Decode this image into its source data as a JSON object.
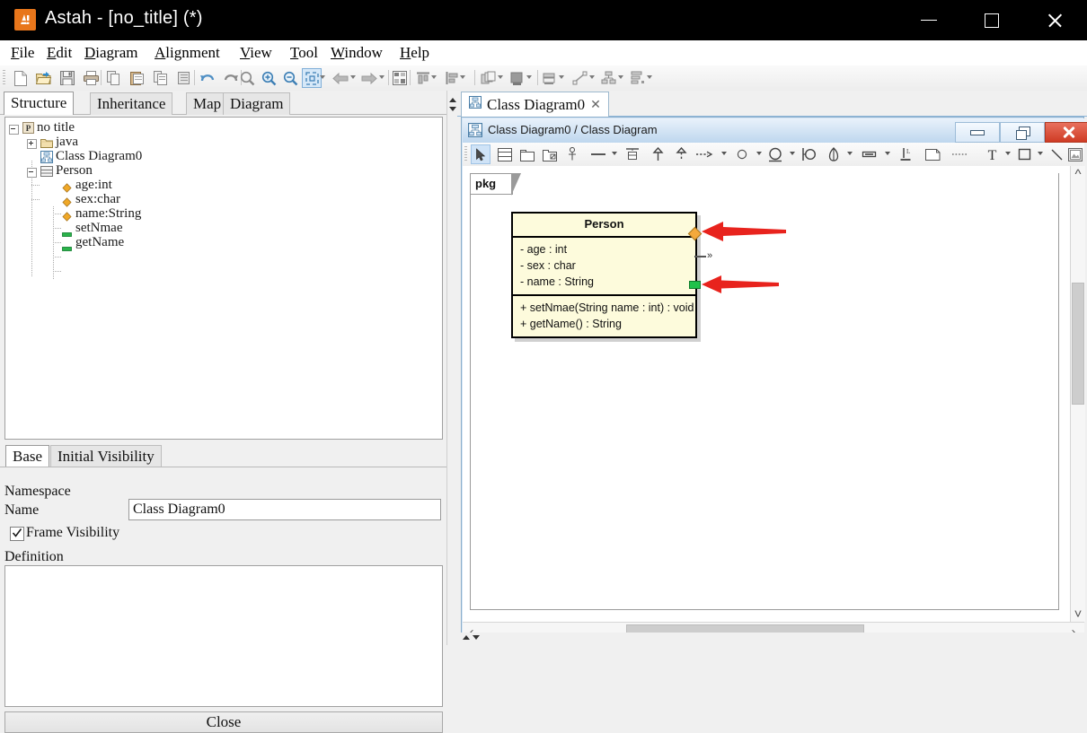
{
  "window": {
    "app_icon": "astah-logo-icon",
    "title": "Astah - [no_title] (*)",
    "minimize": "minimize-icon",
    "maximize": "maximize-icon",
    "close": "close-icon"
  },
  "menubar": {
    "items": [
      {
        "label": "File",
        "mnemonic": "F"
      },
      {
        "label": "Edit",
        "mnemonic": "E"
      },
      {
        "label": "Diagram",
        "mnemonic": "D"
      },
      {
        "label": "Alignment",
        "mnemonic": "A"
      },
      {
        "label": "View",
        "mnemonic": "V"
      },
      {
        "label": "Tool",
        "mnemonic": "T"
      },
      {
        "label": "Window",
        "mnemonic": "W"
      },
      {
        "label": "Help",
        "mnemonic": "H"
      }
    ]
  },
  "toolbar": {
    "buttons": [
      {
        "name": "new-project-icon"
      },
      {
        "name": "open-project-icon"
      },
      {
        "name": "save-icon"
      },
      {
        "name": "print-icon"
      },
      {
        "name": "copy-icon"
      },
      {
        "name": "paste-icon"
      },
      {
        "name": "copy-as-image-icon"
      },
      {
        "name": "paste-special-icon"
      },
      {
        "name": "undo-icon"
      },
      {
        "name": "redo-icon"
      },
      {
        "name": "zoom-reset-icon"
      },
      {
        "name": "zoom-in-icon"
      },
      {
        "name": "zoom-out-icon"
      },
      {
        "name": "fit-to-window-icon"
      },
      {
        "name": "back-icon"
      },
      {
        "name": "forward-icon"
      },
      {
        "name": "layout-icon"
      },
      {
        "name": "align-top-icon"
      },
      {
        "name": "align-left-icon"
      },
      {
        "name": "stack-icon"
      },
      {
        "name": "bring-front-icon"
      },
      {
        "name": "send-back-icon"
      },
      {
        "name": "line-style-icon"
      },
      {
        "name": "tree-layout-icon"
      },
      {
        "name": "list-layout-icon"
      }
    ]
  },
  "left_panel": {
    "tabs": [
      {
        "label": "Structure",
        "active": true
      },
      {
        "label": "Inheritance",
        "active": false
      },
      {
        "label": "Map",
        "active": false
      },
      {
        "label": "Diagram",
        "active": false
      }
    ],
    "tree": [
      {
        "label": "no title",
        "depth": 0,
        "icon": "project-icon",
        "expander": "minus"
      },
      {
        "label": "java",
        "depth": 1,
        "icon": "package-icon",
        "expander": "plus"
      },
      {
        "label": "Class Diagram0",
        "depth": 1,
        "icon": "class-diagram-icon",
        "expander": "none"
      },
      {
        "label": "Person",
        "depth": 1,
        "icon": "class-icon",
        "expander": "minus"
      },
      {
        "label": "age:int",
        "depth": 2,
        "icon": "attribute-icon",
        "expander": "none"
      },
      {
        "label": "sex:char",
        "depth": 2,
        "icon": "attribute-icon",
        "expander": "none"
      },
      {
        "label": "name:String",
        "depth": 2,
        "icon": "attribute-icon",
        "expander": "none"
      },
      {
        "label": "setNmae",
        "depth": 2,
        "icon": "operation-icon",
        "expander": "none"
      },
      {
        "label": "getName",
        "depth": 2,
        "icon": "operation-icon",
        "expander": "none"
      }
    ]
  },
  "property_panel": {
    "tabs": [
      {
        "label": "Base",
        "active": true
      },
      {
        "label": "Initial Visibility",
        "active": false
      }
    ],
    "namespace_label": "Namespace",
    "namespace_value": "",
    "name_label": "Name",
    "name_value": "Class Diagram0",
    "frame_visibility_label": "Frame Visibility",
    "frame_visibility_checked": true,
    "definition_label": "Definition",
    "definition_value": "",
    "close_label": "Close"
  },
  "diagram_tabs": [
    {
      "label": "Class Diagram0",
      "icon": "class-diagram-icon",
      "close": "close-tab-icon",
      "active": true
    }
  ],
  "mdi_window": {
    "icon": "class-diagram-icon",
    "title": "Class Diagram0 / Class Diagram",
    "minimize": "minimize-icon",
    "restore": "restore-icon",
    "close": "close-icon"
  },
  "diagram_toolbar": {
    "buttons": [
      {
        "name": "select-tool-icon",
        "selected": true
      },
      {
        "name": "class-tool-icon"
      },
      {
        "name": "package-tool-icon"
      },
      {
        "name": "subsystem-tool-icon"
      },
      {
        "name": "port-tool-icon"
      },
      {
        "name": "association-tool-icon",
        "dropdown": true
      },
      {
        "name": "association-class-tool-icon"
      },
      {
        "name": "generalization-tool-icon"
      },
      {
        "name": "realization-tool-icon"
      },
      {
        "name": "dependency-tool-icon",
        "dropdown": true
      },
      {
        "name": "usage-tool-icon",
        "dropdown": true
      },
      {
        "name": "interface-tool-icon",
        "dropdown": true
      },
      {
        "name": "required-interface-tool-icon"
      },
      {
        "name": "instance-tool-icon",
        "dropdown": true
      },
      {
        "name": "slot-tool-icon",
        "dropdown": true
      },
      {
        "name": "link-tool-icon"
      },
      {
        "name": "note-tool-icon"
      },
      {
        "name": "note-anchor-tool-icon"
      },
      {
        "name": "text-tool-icon",
        "dropdown": true
      },
      {
        "name": "rectangle-tool-icon",
        "dropdown": true
      },
      {
        "name": "line-tool-icon"
      },
      {
        "name": "image-tool-icon"
      }
    ]
  },
  "diagram": {
    "package_frame_label": "pkg",
    "class": {
      "name": "Person",
      "attributes": [
        "- age : int",
        "- sex : char",
        "- name : String"
      ],
      "operations": [
        "+ setNmae(String name : int) : void",
        "+ getName() : String"
      ],
      "attribute_handle": "attribute-add-handle",
      "operation_handle": "operation-add-handle",
      "stereotype_marker": "»"
    },
    "annotations": [
      {
        "name": "red-arrow-attribute",
        "color": "#e8231d"
      },
      {
        "name": "red-arrow-operation",
        "color": "#e8231d"
      }
    ],
    "colors": {
      "class_fill": "#fdfbdc",
      "class_border": "#000000",
      "attribute_handle": "#f4a93c",
      "operation_handle": "#1fc24a",
      "arrow_red": "#e8231d"
    }
  },
  "scrollbars": {
    "vertical": {
      "up": "scroll-up-icon",
      "down": "scroll-down-icon"
    },
    "horizontal": {
      "left": "scroll-left-icon",
      "right": "scroll-right-icon"
    }
  }
}
